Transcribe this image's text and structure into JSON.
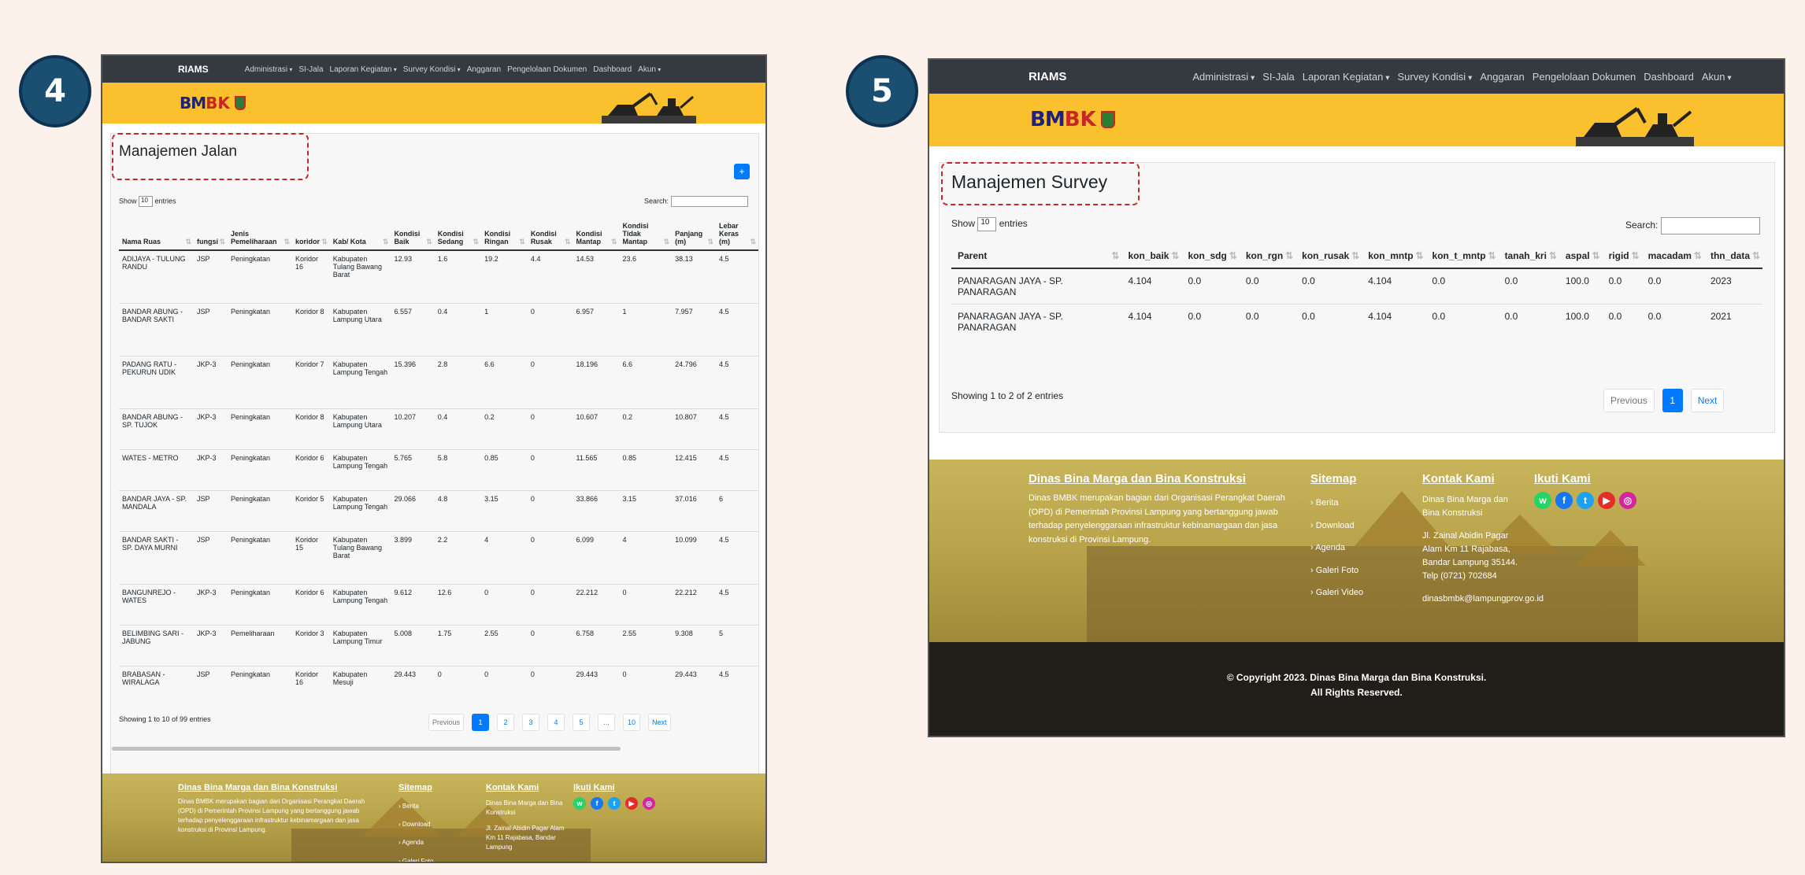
{
  "badges": [
    "4",
    "5"
  ],
  "nav": {
    "brand": "RIAMS",
    "items": [
      {
        "label": "Administrasi",
        "caret": true
      },
      {
        "label": "SI-Jala",
        "caret": false
      },
      {
        "label": "Laporan Kegiatan",
        "caret": true
      },
      {
        "label": "Survey Kondisi",
        "caret": true
      },
      {
        "label": "Anggaran",
        "caret": false
      },
      {
        "label": "Pengelolaan Dokumen",
        "caret": false
      },
      {
        "label": "Dashboard",
        "caret": false
      },
      {
        "label": "Akun",
        "caret": true
      }
    ]
  },
  "logo": {
    "bm": "BM",
    "bk": "BK"
  },
  "left": {
    "title": "Manajemen Jalan",
    "add_label": "+",
    "show_label": "Show",
    "show_value": "10",
    "entries_label": "entries",
    "search_label": "Search:",
    "columns": [
      "Nama Ruas",
      "fungsi",
      "Jenis Pemeliharaan",
      "koridor",
      "Kab/ Kota",
      "Kondisi Baik",
      "Kondisi Sedang",
      "Kondisi Ringan",
      "Kondisi Rusak",
      "Kondisi Mantap",
      "Kondisi Tidak Mantap",
      "Panjang (m)",
      "Lebar Keras (m)"
    ],
    "rows": [
      [
        "ADIJAYA - TULUNG RANDU",
        "JSP",
        "Peningkatan",
        "Koridor 16",
        "Kabupaten Tulang Bawang Barat",
        "12.93",
        "1.6",
        "19.2",
        "4.4",
        "14.53",
        "23.6",
        "38.13",
        "4.5"
      ],
      [
        "BANDAR ABUNG - BANDAR SAKTI",
        "JSP",
        "Peningkatan",
        "Koridor 8",
        "Kabupaten Lampung Utara",
        "6.557",
        "0.4",
        "1",
        "0",
        "6.957",
        "1",
        "7.957",
        "4.5"
      ],
      [
        "PADANG RATU - PEKURUN UDIK",
        "JKP-3",
        "Peningkatan",
        "Koridor 7",
        "Kabupaten Lampung Tengah",
        "15.396",
        "2.8",
        "6.6",
        "0",
        "18.196",
        "6.6",
        "24.796",
        "4.5"
      ],
      [
        "BANDAR ABUNG - SP. TUJOK",
        "JKP-3",
        "Peningkatan",
        "Koridor 8",
        "Kabupaten Lampung Utara",
        "10.207",
        "0.4",
        "0.2",
        "0",
        "10.607",
        "0.2",
        "10.807",
        "4.5"
      ],
      [
        "WATES - METRO",
        "JKP-3",
        "Peningkatan",
        "Koridor 6",
        "Kabupaten Lampung Tengah",
        "5.765",
        "5.8",
        "0.85",
        "0",
        "11.565",
        "0.85",
        "12.415",
        "4.5"
      ],
      [
        "BANDAR JAYA - SP. MANDALA",
        "JSP",
        "Peningkatan",
        "Koridor 5",
        "Kabupaten Lampung Tengah",
        "29.066",
        "4.8",
        "3.15",
        "0",
        "33.866",
        "3.15",
        "37.016",
        "6"
      ],
      [
        "BANDAR SAKTI - SP. DAYA MURNI",
        "JSP",
        "Peningkatan",
        "Koridor 15",
        "Kabupaten Tulang Bawang Barat",
        "3.899",
        "2.2",
        "4",
        "0",
        "6.099",
        "4",
        "10.099",
        "4.5"
      ],
      [
        "BANGUNREJO - WATES",
        "JKP-3",
        "Peningkatan",
        "Koridor 6",
        "Kabupaten Lampung Tengah",
        "9.612",
        "12.6",
        "0",
        "0",
        "22.212",
        "0",
        "22.212",
        "4.5"
      ],
      [
        "BELIMBING SARI - JABUNG",
        "JKP-3",
        "Pemeliharaan",
        "Koridor 3",
        "Kabupaten Lampung Timur",
        "5.008",
        "1.75",
        "2.55",
        "0",
        "6.758",
        "2.55",
        "9.308",
        "5"
      ],
      [
        "BRABASAN - WIRALAGA",
        "JSP",
        "Peningkatan",
        "Koridor 16",
        "Kabupaten Mesuji",
        "29.443",
        "0",
        "0",
        "0",
        "29.443",
        "0",
        "29.443",
        "4.5"
      ]
    ],
    "info": "Showing 1 to 10 of 99 entries",
    "pages": [
      "Previous",
      "1",
      "2",
      "3",
      "4",
      "5",
      "...",
      "10",
      "Next"
    ],
    "active_page": "1"
  },
  "right": {
    "title": "Manajemen Survey",
    "show_label": "Show",
    "show_value": "10",
    "entries_label": "entries",
    "search_label": "Search:",
    "columns": [
      "Parent",
      "kon_baik",
      "kon_sdg",
      "kon_rgn",
      "kon_rusak",
      "kon_mntp",
      "kon_t_mntp",
      "tanah_kri",
      "aspal",
      "rigid",
      "macadam",
      "thn_data"
    ],
    "rows": [
      [
        "PANARAGAN JAYA - SP. PANARAGAN",
        "4.104",
        "0.0",
        "0.0",
        "0.0",
        "4.104",
        "0.0",
        "0.0",
        "100.0",
        "0.0",
        "0.0",
        "2023"
      ],
      [
        "PANARAGAN JAYA - SP. PANARAGAN",
        "4.104",
        "0.0",
        "0.0",
        "0.0",
        "4.104",
        "0.0",
        "0.0",
        "100.0",
        "0.0",
        "0.0",
        "2021"
      ]
    ],
    "info": "Showing 1 to 2 of 2 entries",
    "pages": [
      "Previous",
      "1",
      "Next"
    ],
    "active_page": "1"
  },
  "footer": {
    "org_title": "Dinas Bina Marga dan Bina Konstruksi",
    "org_desc": "Dinas BMBK merupakan bagian dari Organisasi Perangkat Daerah (OPD) di Pemerintah Provinsi Lampung yang bertanggung jawab terhadap penyelenggaraan infrastruktur kebinamargaan dan jasa konstruksi di Provinsi Lampung.",
    "sitemap_title": "Sitemap",
    "sitemap": [
      "Berita",
      "Download",
      "Agenda",
      "Galeri Foto",
      "Galeri Video"
    ],
    "contact_title": "Kontak Kami",
    "contact_name": "Dinas Bina Marga dan Bina Konstruksi",
    "contact_addr": "Jl. Zainal Abidin Pagar Alam Km 11 Rajabasa, Bandar Lampung 35144. Telp (0721) 702684",
    "contact_addr_short": "Jl. Zainal Abidin Pagar Alam Km 11 Rajabasa, Bandar Lampung",
    "contact_email": "dinasbmbk@lampungprov.go.id",
    "follow_title": "Ikuti Kami",
    "social": [
      {
        "name": "whatsapp-icon",
        "glyph": "w",
        "color": "#25d366"
      },
      {
        "name": "facebook-icon",
        "glyph": "f",
        "color": "#1877f2"
      },
      {
        "name": "twitter-icon",
        "glyph": "t",
        "color": "#1da1f2"
      },
      {
        "name": "youtube-icon",
        "glyph": "▶",
        "color": "#e52d27"
      },
      {
        "name": "instagram-icon",
        "glyph": "◎",
        "color": "#d6249f"
      }
    ],
    "copyright_1": "© Copyright 2023. Dinas Bina Marga dan Bina Konstruksi.",
    "copyright_2": "All Rights Reserved."
  }
}
